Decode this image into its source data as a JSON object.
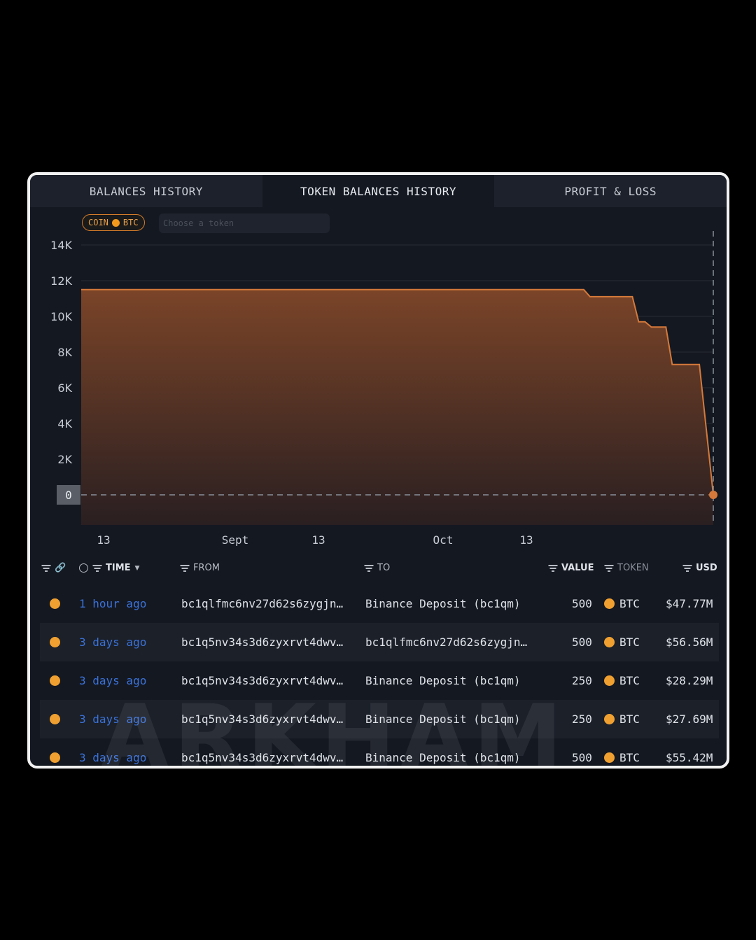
{
  "tabs": [
    {
      "label": "BALANCES HISTORY",
      "active": false
    },
    {
      "label": "TOKEN BALANCES HISTORY",
      "active": true
    },
    {
      "label": "PROFIT & LOSS",
      "active": false
    }
  ],
  "filter": {
    "coin_label": "COIN",
    "coin_value": "BTC",
    "token_placeholder": "Choose a token"
  },
  "chart_data": {
    "type": "area",
    "y_ticks": [
      "14K",
      "12K",
      "10K",
      "8K",
      "6K",
      "4K",
      "2K",
      "0"
    ],
    "x_ticks": [
      "13",
      "Sept",
      "13",
      "Oct",
      "13"
    ],
    "ylim": [
      0,
      14000
    ],
    "points": [
      [
        0.0,
        11500
      ],
      [
        0.795,
        11500
      ],
      [
        0.805,
        11100
      ],
      [
        0.872,
        11100
      ],
      [
        0.882,
        9700
      ],
      [
        0.892,
        9700
      ],
      [
        0.902,
        9400
      ],
      [
        0.925,
        9400
      ],
      [
        0.935,
        7300
      ],
      [
        0.978,
        7300
      ],
      [
        1.0,
        0
      ]
    ],
    "color": "#d4793a",
    "grid": true
  },
  "table": {
    "headers": {
      "time": "TIME",
      "from": "FROM",
      "to": "TO",
      "value": "VALUE",
      "token": "TOKEN",
      "usd": "USD"
    },
    "rows": [
      {
        "time": "1 hour ago",
        "from": "bc1qlfmc6nv27d62s6zygjn…",
        "to": "Binance Deposit (bc1qm)",
        "value": "500",
        "token": "BTC",
        "usd": "$47.77M"
      },
      {
        "time": "3 days ago",
        "from": "bc1q5nv34s3d6zyxrvt4dwv…",
        "to": "bc1qlfmc6nv27d62s6zygjn…",
        "value": "500",
        "token": "BTC",
        "usd": "$56.56M"
      },
      {
        "time": "3 days ago",
        "from": "bc1q5nv34s3d6zyxrvt4dwv…",
        "to": "Binance Deposit (bc1qm)",
        "value": "250",
        "token": "BTC",
        "usd": "$28.29M"
      },
      {
        "time": "3 days ago",
        "from": "bc1q5nv34s3d6zyxrvt4dwv…",
        "to": "Binance Deposit (bc1qm)",
        "value": "250",
        "token": "BTC",
        "usd": "$27.69M"
      },
      {
        "time": "3 days ago",
        "from": "bc1q5nv34s3d6zyxrvt4dwv…",
        "to": "Binance Deposit (bc1qm)",
        "value": "500",
        "token": "BTC",
        "usd": "$55.42M"
      }
    ]
  },
  "watermark": "ARKHAM"
}
